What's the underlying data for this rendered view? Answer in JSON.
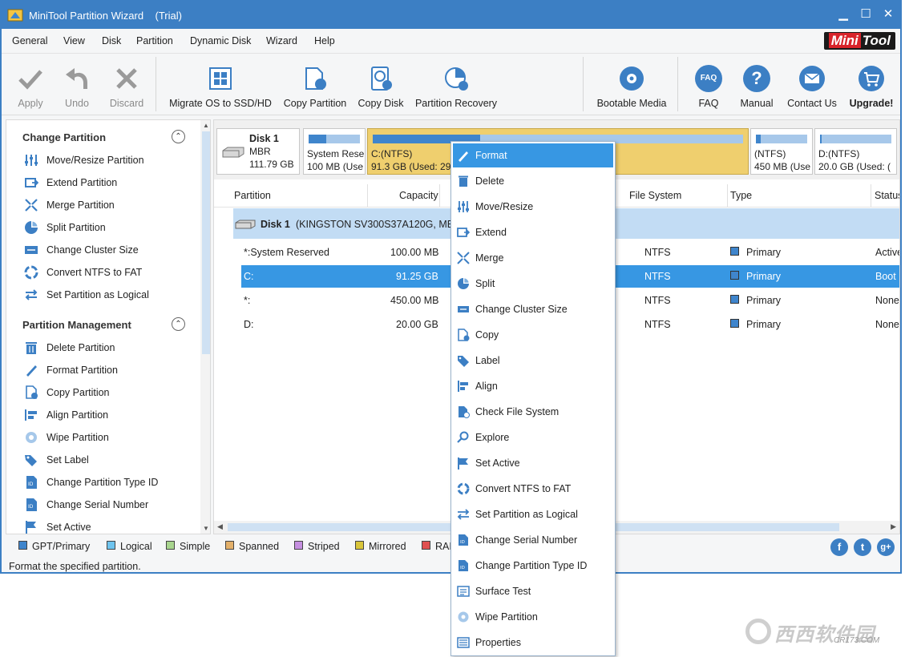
{
  "window": {
    "title": "MiniTool Partition Wizard",
    "edition": "(Trial)",
    "min": "▁",
    "max": "☐",
    "close": "✕"
  },
  "menu": [
    "General",
    "View",
    "Disk",
    "Partition",
    "Dynamic Disk",
    "Wizard",
    "Help"
  ],
  "brand": {
    "mini": "Mini",
    "tool": "Tool"
  },
  "toolbar": {
    "apply": "Apply",
    "undo": "Undo",
    "discard": "Discard",
    "migrate": "Migrate OS to SSD/HD",
    "copy_partition": "Copy Partition",
    "copy_disk": "Copy Disk",
    "recovery": "Partition Recovery",
    "bootable": "Bootable Media",
    "faq": "FAQ",
    "manual": "Manual",
    "contact": "Contact Us",
    "upgrade": "Upgrade!",
    "faq_badge": "FAQ"
  },
  "sidebar": {
    "change_header": "Change Partition",
    "change_items": [
      "Move/Resize Partition",
      "Extend Partition",
      "Merge Partition",
      "Split Partition",
      "Change Cluster Size",
      "Convert NTFS to FAT",
      "Set Partition as Logical"
    ],
    "mgmt_header": "Partition Management",
    "mgmt_items": [
      "Delete Partition",
      "Format Partition",
      "Copy Partition",
      "Align Partition",
      "Wipe Partition",
      "Set Label",
      "Change Partition Type ID",
      "Change Serial Number",
      "Set Active"
    ],
    "toggle": "⌃"
  },
  "diskmap": {
    "disk_name": "Disk 1",
    "disk_type": "MBR",
    "disk_size": "111.79 GB",
    "parts": [
      {
        "name": "System Rese",
        "size": "100 MB (Use",
        "used_fraction": 0.35
      },
      {
        "name": "C:(NTFS)",
        "size": "91.3 GB (Used: 29",
        "used_fraction": 0.29
      },
      {
        "name": "(NTFS)",
        "size": "450 MB (Use",
        "used_fraction": 0.1
      },
      {
        "name": "D:(NTFS)",
        "size": "20.0 GB (Used: (",
        "used_fraction": 0.02
      }
    ]
  },
  "table": {
    "headers": {
      "partition": "Partition",
      "capacity": "Capacity",
      "fs": "File System",
      "type": "Type",
      "status": "Status"
    },
    "disk_label": "Disk 1",
    "disk_desc": "(KINGSTON SV300S37A120G, MBR",
    "rows": [
      {
        "partition": "*:System Reserved",
        "capacity": "100.00 MB",
        "fs": "NTFS",
        "type": "Primary",
        "status": "Active"
      },
      {
        "partition": "C:",
        "capacity": "91.25 GB",
        "fs": "NTFS",
        "type": "Primary",
        "status": "Boot"
      },
      {
        "partition": "*:",
        "capacity": "450.00 MB",
        "fs": "NTFS",
        "type": "Primary",
        "status": "None"
      },
      {
        "partition": "D:",
        "capacity": "20.00 GB",
        "fs": "NTFS",
        "type": "Primary",
        "status": "None"
      }
    ]
  },
  "legend": [
    {
      "label": "GPT/Primary",
      "color": "#3f85cc"
    },
    {
      "label": "Logical",
      "color": "#6fc4ee"
    },
    {
      "label": "Simple",
      "color": "#a8d58e"
    },
    {
      "label": "Spanned",
      "color": "#e3b06a"
    },
    {
      "label": "Striped",
      "color": "#c58fe0"
    },
    {
      "label": "Mirrored",
      "color": "#d9c53a"
    },
    {
      "label": "RAI",
      "color": "#e05050"
    }
  ],
  "social": {
    "facebook": "f",
    "twitter": "t",
    "google": "g+"
  },
  "status_text": "Format the specified partition.",
  "context_menu": [
    "Format",
    "Delete",
    "Move/Resize",
    "Extend",
    "Merge",
    "Split",
    "Change Cluster Size",
    "Copy",
    "Label",
    "Align",
    "Check File System",
    "Explore",
    "Set Active",
    "Convert NTFS to FAT",
    "Set Partition as Logical",
    "Change Serial Number",
    "Change Partition Type ID",
    "Surface Test",
    "Wipe Partition",
    "Properties"
  ],
  "watermark": {
    "brand": "西西软件园",
    "url": "CR173.COM"
  },
  "colors": {
    "accent": "#3c7fc4",
    "selection": "#3797e3",
    "disk_row": "#c2dcf4",
    "c_partition": "#efcf6e"
  }
}
